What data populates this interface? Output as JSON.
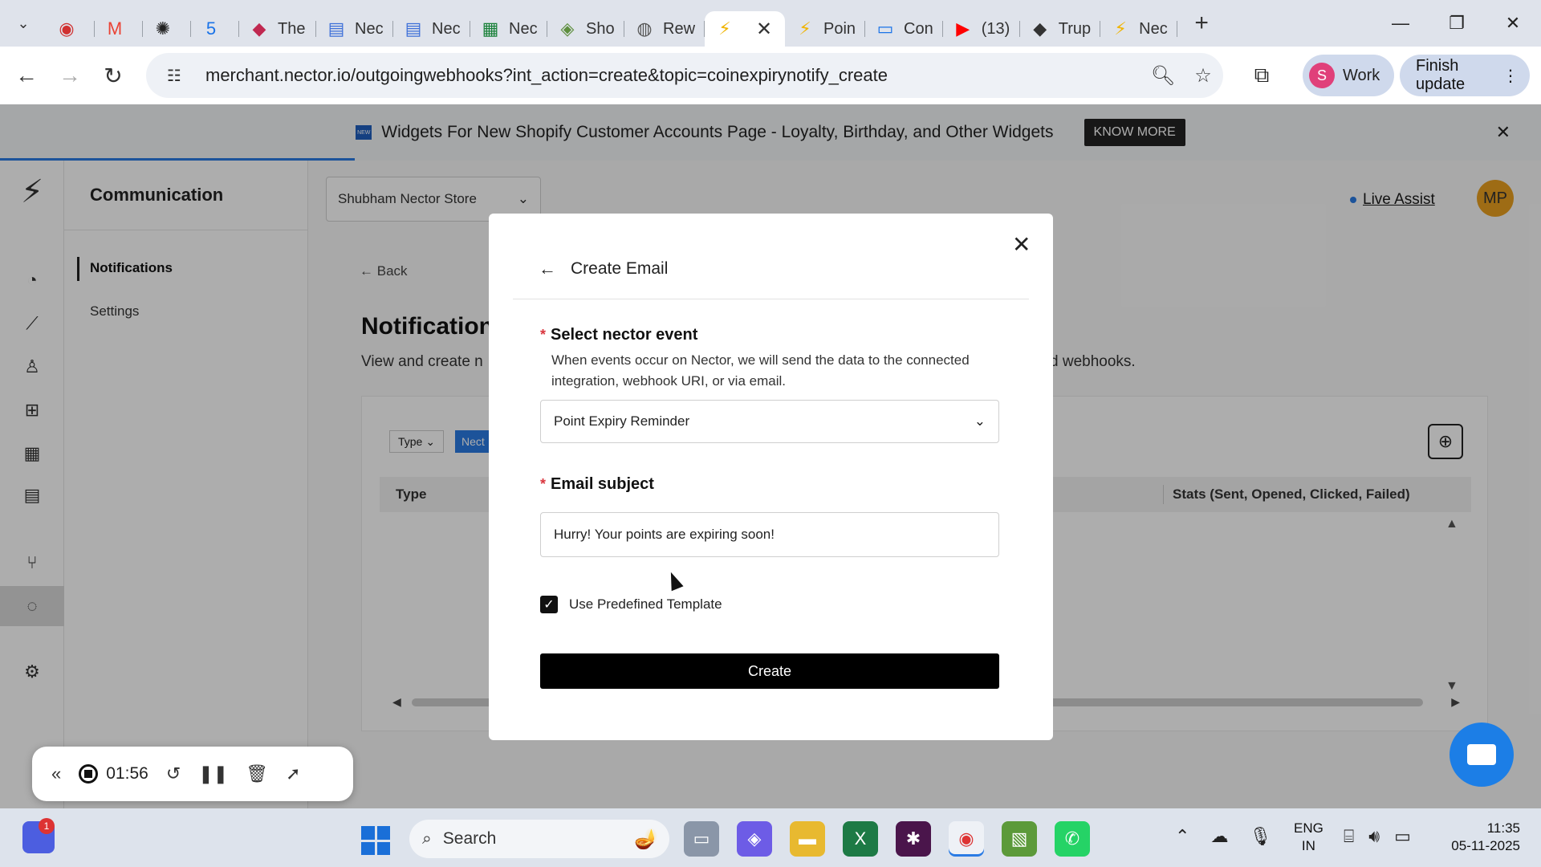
{
  "browser": {
    "tabs": [
      {
        "label": "",
        "icon": "screen-record-icon",
        "color": "#d03030"
      },
      {
        "label": "",
        "icon": "gmail-icon",
        "color": "#ea4335"
      },
      {
        "label": "",
        "icon": "chatgpt-icon",
        "color": "#222222"
      },
      {
        "label": "",
        "icon": "calendar-icon",
        "color": "#1a73e8"
      },
      {
        "label": "The",
        "icon": "app-icon",
        "color": "#c02850"
      },
      {
        "label": "Nec",
        "icon": "docs-icon",
        "color": "#3b6ed8"
      },
      {
        "label": "Nec",
        "icon": "docs-icon",
        "color": "#3b6ed8"
      },
      {
        "label": "Nec",
        "icon": "sheets-icon",
        "color": "#188038"
      },
      {
        "label": "Sho",
        "icon": "shopify-icon",
        "color": "#5e8e3e"
      },
      {
        "label": "Rew",
        "icon": "globe-icon",
        "color": "#555555"
      },
      {
        "label": "",
        "icon": "nector-bolt-icon",
        "color": "#f0b400",
        "active": true
      },
      {
        "label": "Poin",
        "icon": "nector-bolt-icon",
        "color": "#f0b400"
      },
      {
        "label": "Con",
        "icon": "chat-icon",
        "color": "#1a73e8"
      },
      {
        "label": "(13)",
        "icon": "youtube-icon",
        "color": "#ff0000"
      },
      {
        "label": "Trup",
        "icon": "app-icon",
        "color": "#333333"
      },
      {
        "label": "Nec",
        "icon": "nector-bolt-icon",
        "color": "#f0b400"
      }
    ],
    "url": "merchant.nector.io/outgoingwebhooks?int_action=create&topic=coinexpirynotify_create",
    "profile": {
      "initial": "S",
      "name": "Work"
    },
    "finish_update": "Finish update"
  },
  "banner": {
    "text": "Widgets For New Shopify Customer Accounts Page - Loyalty, Birthday, and Other Widgets",
    "cta": "KNOW MORE",
    "new_tag": "NEW"
  },
  "sidebar": {
    "title": "Communication",
    "items": [
      {
        "label": "Notifications",
        "selected": true
      },
      {
        "label": "Settings",
        "selected": false
      }
    ]
  },
  "header": {
    "store": "Shubham Nector Store",
    "live_assist": "Live Assist",
    "avatar_initials": "MP"
  },
  "page": {
    "back": "Back",
    "title": "Notification",
    "subtitle_left": "View and create n",
    "subtitle_right": "d webhooks.",
    "filter_type": "Type",
    "filter_nector": "Nect",
    "col_type": "Type",
    "col_stats": "Stats (Sent, Opened, Clicked, Failed)"
  },
  "modal": {
    "title": "Create Email",
    "event_label": "Select nector event",
    "event_desc": "When events occur on Nector, we will send the data to the connected integration, webhook URI, or via email.",
    "event_value": "Point Expiry Reminder",
    "subject_label": "Email subject",
    "subject_value": "Hurry! Your points are expiring soon!",
    "template_label": "Use Predefined Template",
    "template_checked": true,
    "create_label": "Create"
  },
  "recorder": {
    "time": "01:56"
  },
  "taskbar": {
    "badge": "1",
    "search": "Search",
    "lang_line1": "ENG",
    "lang_line2": "IN",
    "time": "11:35",
    "date": "05-11-2025"
  }
}
